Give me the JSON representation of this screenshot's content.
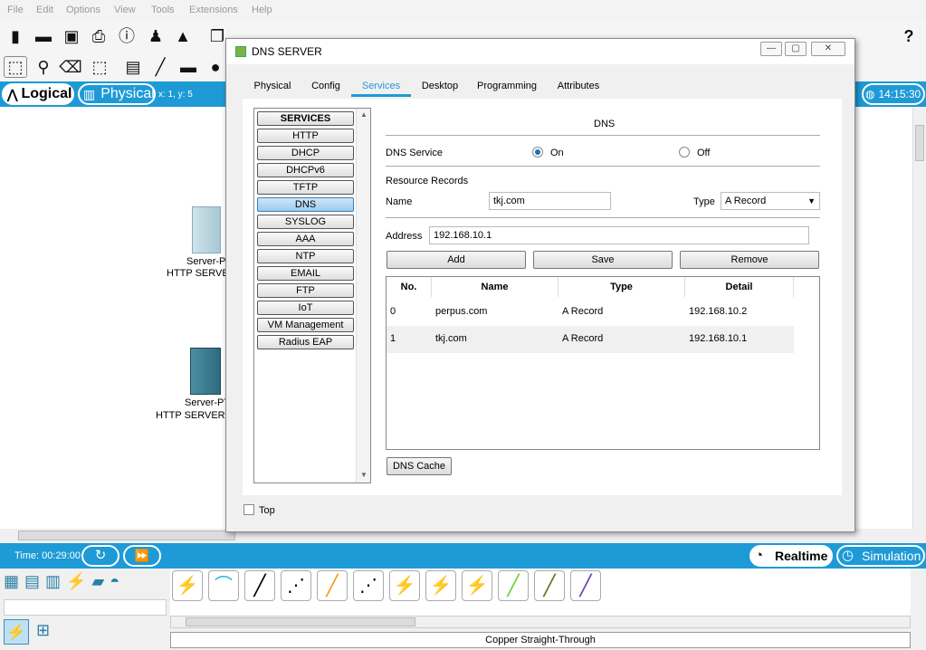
{
  "menu": [
    "File",
    "Edit",
    "Options",
    "View",
    "Tools",
    "Extensions",
    "Help"
  ],
  "view_tabs": {
    "logical": "Logical",
    "physical": "Physical",
    "coords": "x: 1, y: 5",
    "clock": "14:15:30"
  },
  "workspace": {
    "devices": [
      {
        "name": "Server-P",
        "sub": "HTTP SERVER"
      },
      {
        "name": "Server-PT",
        "sub": "HTTP SERVER P"
      }
    ]
  },
  "bottom": {
    "time": "Time: 00:29:00",
    "realtime": "Realtime",
    "simulation": "Simulation",
    "cable_label": "Copper Straight-Through"
  },
  "dialog": {
    "title": "DNS SERVER",
    "controls": {
      "minimize": "—",
      "maximize": "▢",
      "close": "✕"
    },
    "tabs": [
      "Physical",
      "Config",
      "Services",
      "Desktop",
      "Programming",
      "Attributes"
    ],
    "services": [
      "SERVICES",
      "HTTP",
      "DHCP",
      "DHCPv6",
      "TFTP",
      "DNS",
      "SYSLOG",
      "AAA",
      "NTP",
      "EMAIL",
      "FTP",
      "IoT",
      "VM Management",
      "Radius EAP"
    ],
    "selected_service": "DNS",
    "panel": {
      "heading": "DNS",
      "dns_service_label": "DNS Service",
      "on_label": "On",
      "off_label": "Off",
      "dns_service_state": "On",
      "resource_records": "Resource Records",
      "name_label": "Name",
      "name_value": "tkj.com",
      "type_label": "Type",
      "type_value": "A Record",
      "address_label": "Address",
      "address_value": "192.168.10.1",
      "add": "Add",
      "save": "Save",
      "remove": "Remove",
      "columns": [
        "No.",
        "Name",
        "Type",
        "Detail"
      ],
      "rows": [
        {
          "no": "0",
          "name": "perpus.com",
          "type": "A Record",
          "detail": "192.168.10.2"
        },
        {
          "no": "1",
          "name": "tkj.com",
          "type": "A Record",
          "detail": "192.168.10.1"
        }
      ],
      "dns_cache": "DNS Cache"
    },
    "top_label": "Top"
  }
}
